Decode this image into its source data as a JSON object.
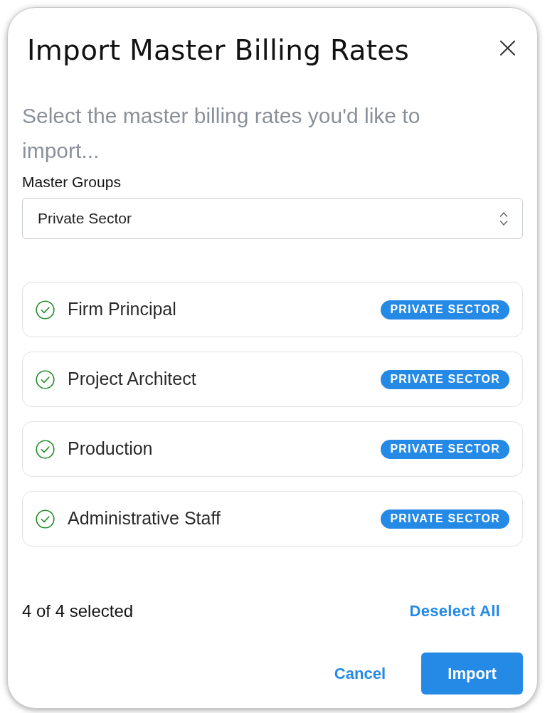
{
  "dialog": {
    "title": "Import Master Billing Rates",
    "subtitle": "Select the master billing rates you'd like to import..."
  },
  "master_groups": {
    "label": "Master Groups",
    "value": "Private Sector"
  },
  "rates": [
    {
      "name": "Firm Principal",
      "badge": "PRIVATE SECTOR",
      "selected": true
    },
    {
      "name": "Project Architect",
      "badge": "PRIVATE SECTOR",
      "selected": true
    },
    {
      "name": "Production",
      "badge": "PRIVATE SECTOR",
      "selected": true
    },
    {
      "name": "Administrative Staff",
      "badge": "PRIVATE SECTOR",
      "selected": true
    }
  ],
  "selection_summary": "4 of 4 selected",
  "deselect_all": "Deselect All",
  "buttons": [
    {
      "label": "Cancel",
      "kind": "text"
    },
    {
      "label": "Import",
      "kind": "primary"
    }
  ]
}
